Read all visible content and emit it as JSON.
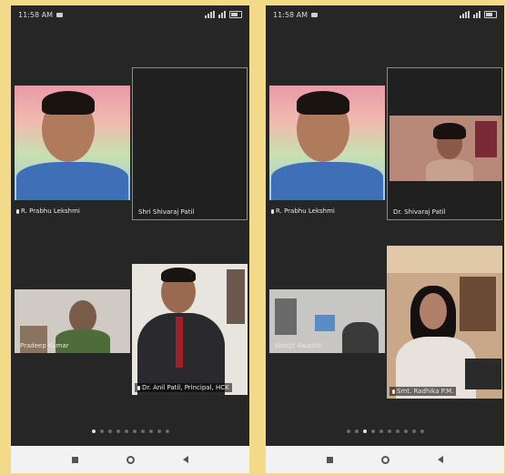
{
  "left": {
    "status": {
      "time": "11:58 AM"
    },
    "tiles": [
      {
        "name": "R. Prabhu Lekshmi"
      },
      {
        "name": "Shri Shivaraj Patil"
      },
      {
        "name": "Pradeep Kumar"
      },
      {
        "name": "Dr. Anil Patil, Principal, HCK"
      }
    ],
    "pager": {
      "pages": 10,
      "active": 0
    }
  },
  "right": {
    "status": {
      "time": "11:58 AM"
    },
    "tiles": [
      {
        "name": "R. Prabhu Lekshmi"
      },
      {
        "name": "Dr. Shivaraj Patil"
      },
      {
        "name": "Abhijit Awasthi"
      },
      {
        "name": "Smt. Radhika P.M."
      }
    ],
    "pager": {
      "pages": 10,
      "active": 2
    }
  },
  "colors": {
    "app_bg": "#262626",
    "backdrop": "#f3d98a",
    "nav_bg": "#f2f2f2"
  }
}
